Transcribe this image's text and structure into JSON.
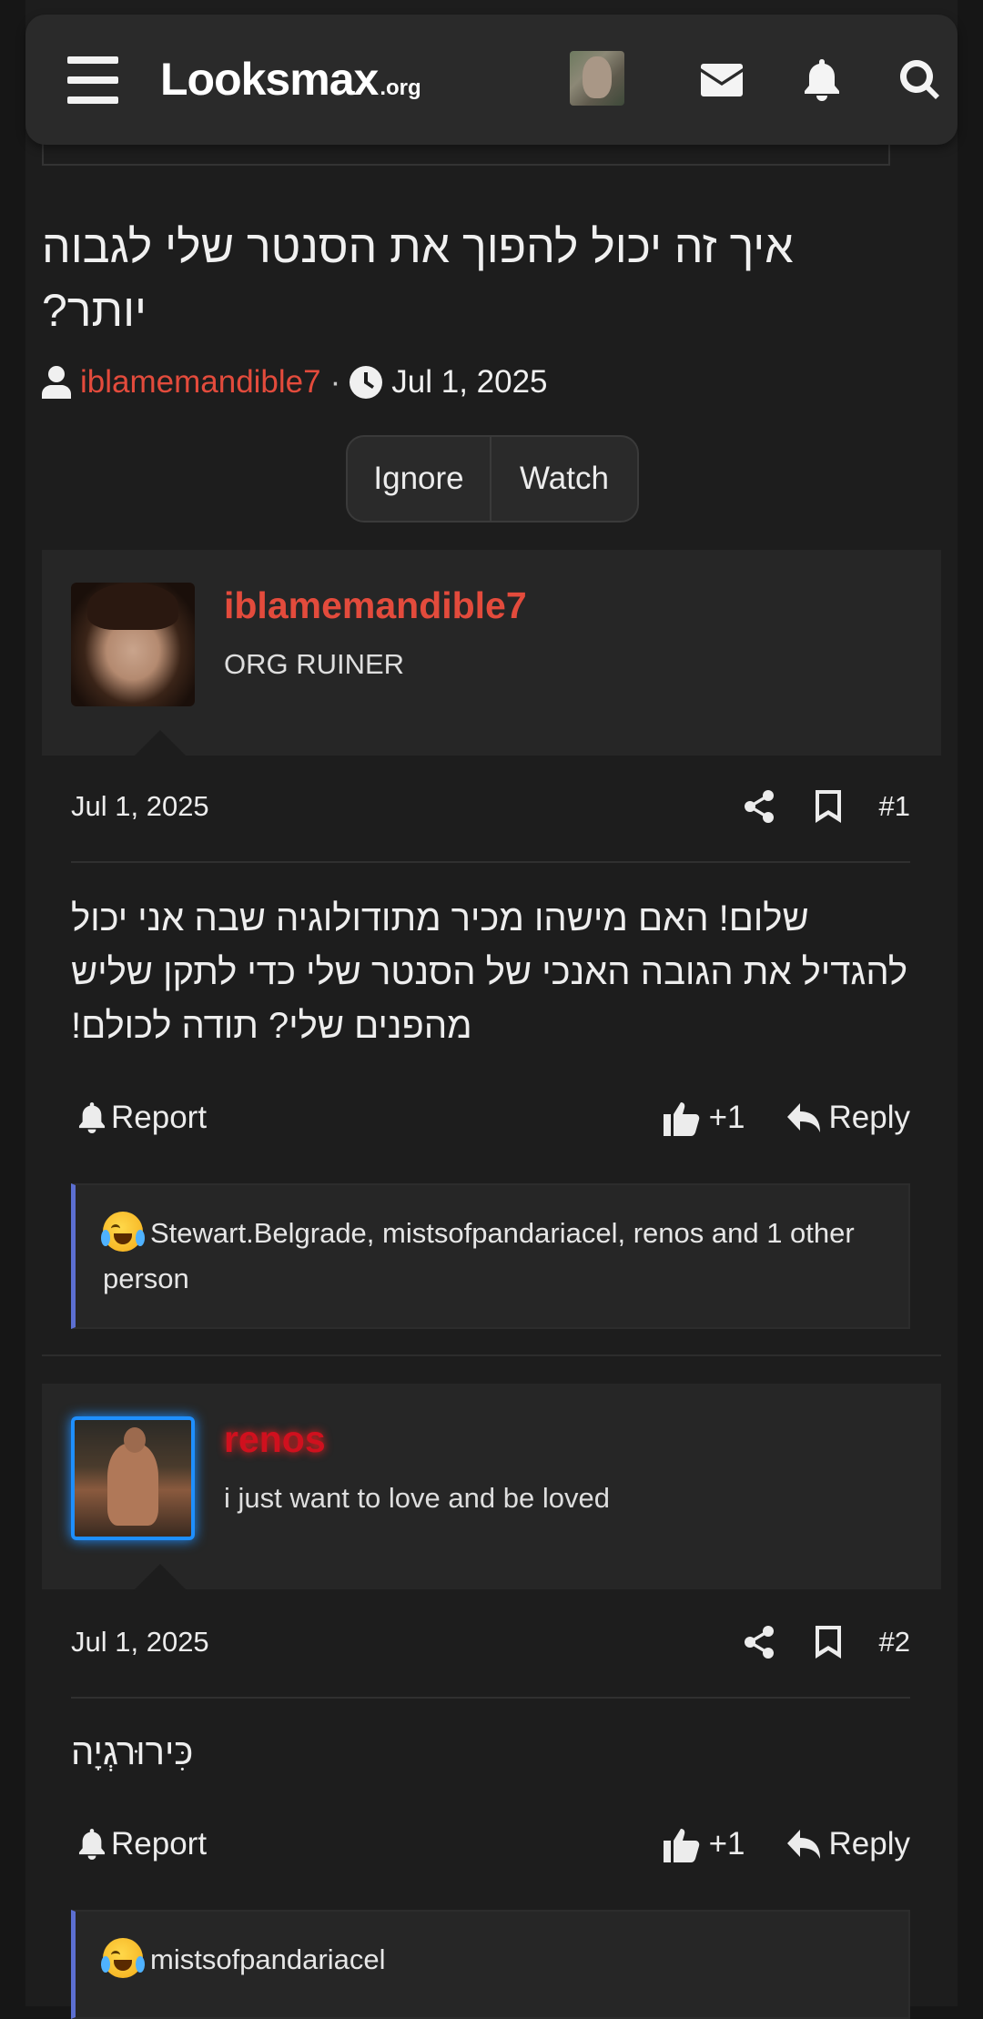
{
  "header": {
    "logo_main": "Looksmax",
    "logo_sub": ".org"
  },
  "thread": {
    "title": "איך זה יכול להפוך את הסנטר שלי לגבוה יותר?",
    "author": "iblamemandible7",
    "separator": "·",
    "date": "Jul 1, 2025",
    "buttons": [
      "Ignore",
      "Watch"
    ]
  },
  "posts": [
    {
      "username": "iblamemandible7",
      "user_title": "ORG RUINER",
      "date": "Jul 1, 2025",
      "number": "#1",
      "body": "שלום! האם מישהו מכיר מתודולוגיה שבה אני יכול להגדיל את הגובה האנכי של הסנטר שלי כדי לתקן שליש מהפנים שלי? תודה לכולם!",
      "report_label": "Report",
      "like_label": "+1",
      "reply_label": "Reply",
      "reactions": "Stewart.Belgrade, mistsofpandariacel, renos and 1 other person"
    },
    {
      "username": "renos",
      "user_title": "i just want to love and be loved",
      "date": "Jul 1, 2025",
      "number": "#2",
      "body": "כִּירוּרגְיָה",
      "report_label": "Report",
      "like_label": "+1",
      "reply_label": "Reply",
      "reactions": "mistsofpandariacel"
    }
  ],
  "colors": {
    "username": "#e34b3c",
    "reaction_bar": "#5c6fd1",
    "renos_glow": "#1e8fff"
  }
}
